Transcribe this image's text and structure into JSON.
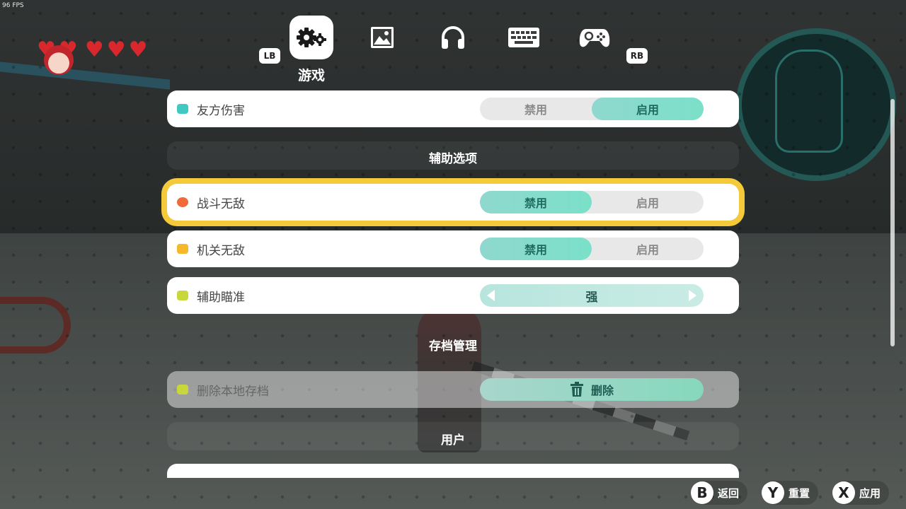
{
  "hud": {
    "fps": "96 FPS",
    "hearts": 5
  },
  "tabs": {
    "lb": "LB",
    "rb": "RB",
    "active_label": "游戏",
    "items": [
      {
        "icon": "gear-icon",
        "active": true
      },
      {
        "icon": "image-icon",
        "active": false
      },
      {
        "icon": "headphones-icon",
        "active": false
      },
      {
        "icon": "keyboard-icon",
        "active": false
      },
      {
        "icon": "gamepad-icon",
        "active": false
      }
    ]
  },
  "rows": {
    "friendly_fire": {
      "label": "友方伤害",
      "off": "禁用",
      "on": "启用",
      "selected": "on",
      "icon_color": "#3fc9c2"
    },
    "combat_invincible": {
      "label": "战斗无敌",
      "off": "禁用",
      "on": "启用",
      "selected": "off",
      "icon_color": "#f06a3a"
    },
    "trap_invincible": {
      "label": "机关无敌",
      "off": "禁用",
      "on": "启用",
      "selected": "off",
      "icon_color": "#f5b82a"
    },
    "aim_assist": {
      "label": "辅助瞄准",
      "value": "强",
      "icon_color": "#c8d83a"
    },
    "delete_save": {
      "label": "删除本地存档",
      "button": "删除",
      "icon_color": "#c8d83a"
    }
  },
  "sections": {
    "assist": "辅助选项",
    "save": "存档管理",
    "user": "用户"
  },
  "footer": {
    "back": {
      "key": "B",
      "label": "返回"
    },
    "reset": {
      "key": "Y",
      "label": "重置"
    },
    "apply": {
      "key": "X",
      "label": "应用"
    }
  },
  "colors": {
    "selection": "#f4c93a",
    "toggle_on": "#7be0c9",
    "heart": "#d8282d"
  }
}
